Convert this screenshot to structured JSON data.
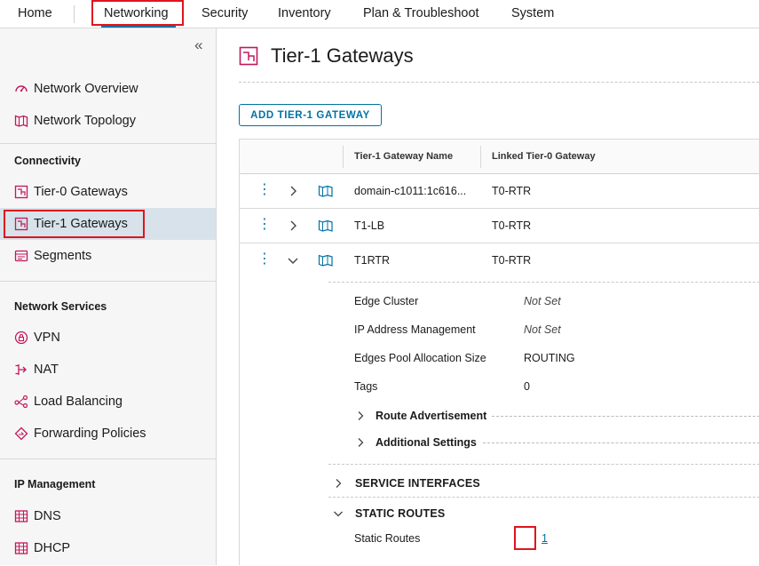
{
  "topnav": {
    "items": [
      {
        "label": "Home"
      },
      {
        "label": "Networking"
      },
      {
        "label": "Security"
      },
      {
        "label": "Inventory"
      },
      {
        "label": "Plan & Troubleshoot"
      },
      {
        "label": "System"
      }
    ]
  },
  "sidebar": {
    "collapse_glyph": "«",
    "items": [
      {
        "label": "Network Overview",
        "icon": "gauge-icon"
      },
      {
        "label": "Network Topology",
        "icon": "topology-icon"
      },
      {
        "label": "Tier-0 Gateways",
        "icon": "tier0-gateway-icon"
      },
      {
        "label": "Tier-1 Gateways",
        "icon": "tier1-gateway-icon"
      },
      {
        "label": "Segments",
        "icon": "segments-icon"
      },
      {
        "label": "VPN",
        "icon": "vpn-lock-icon"
      },
      {
        "label": "NAT",
        "icon": "nat-icon"
      },
      {
        "label": "Load Balancing",
        "icon": "load-balancing-icon"
      },
      {
        "label": "Forwarding Policies",
        "icon": "forwarding-icon"
      },
      {
        "label": "DNS",
        "icon": "dns-icon"
      },
      {
        "label": "DHCP",
        "icon": "dhcp-icon"
      }
    ],
    "headers": {
      "connectivity": "Connectivity",
      "network_services": "Network Services",
      "ip_management": "IP Management"
    }
  },
  "main": {
    "title": "Tier-1 Gateways",
    "add_button": "ADD TIER-1 GATEWAY",
    "columns": [
      "Tier-1 Gateway Name",
      "Linked Tier-0 Gateway"
    ],
    "rows": [
      {
        "name": "domain-c1011:1c616...",
        "linked": "T0-RTR"
      },
      {
        "name": "T1-LB",
        "linked": "T0-RTR"
      },
      {
        "name": "T1RTR",
        "linked": "T0-RTR"
      }
    ],
    "row_menu_glyph": "⋮",
    "detail": {
      "fields": [
        {
          "label": "Edge Cluster",
          "value": "Not Set"
        },
        {
          "label": "IP Address Management",
          "value": "Not Set"
        },
        {
          "label": "Edges Pool Allocation Size",
          "value": "ROUTING"
        },
        {
          "label": "Tags",
          "value": "0"
        }
      ],
      "subsections": [
        "Route Advertisement",
        "Additional Settings"
      ],
      "sections": [
        "SERVICE INTERFACES",
        "STATIC ROUTES"
      ],
      "static_routes_label": "Static Routes",
      "static_routes_count": "1"
    }
  },
  "colors": {
    "accent": "#0072a3",
    "icon_pink": "#c2185b",
    "highlight_red": "#e0141e",
    "selected_bg": "#d7e2ea"
  }
}
